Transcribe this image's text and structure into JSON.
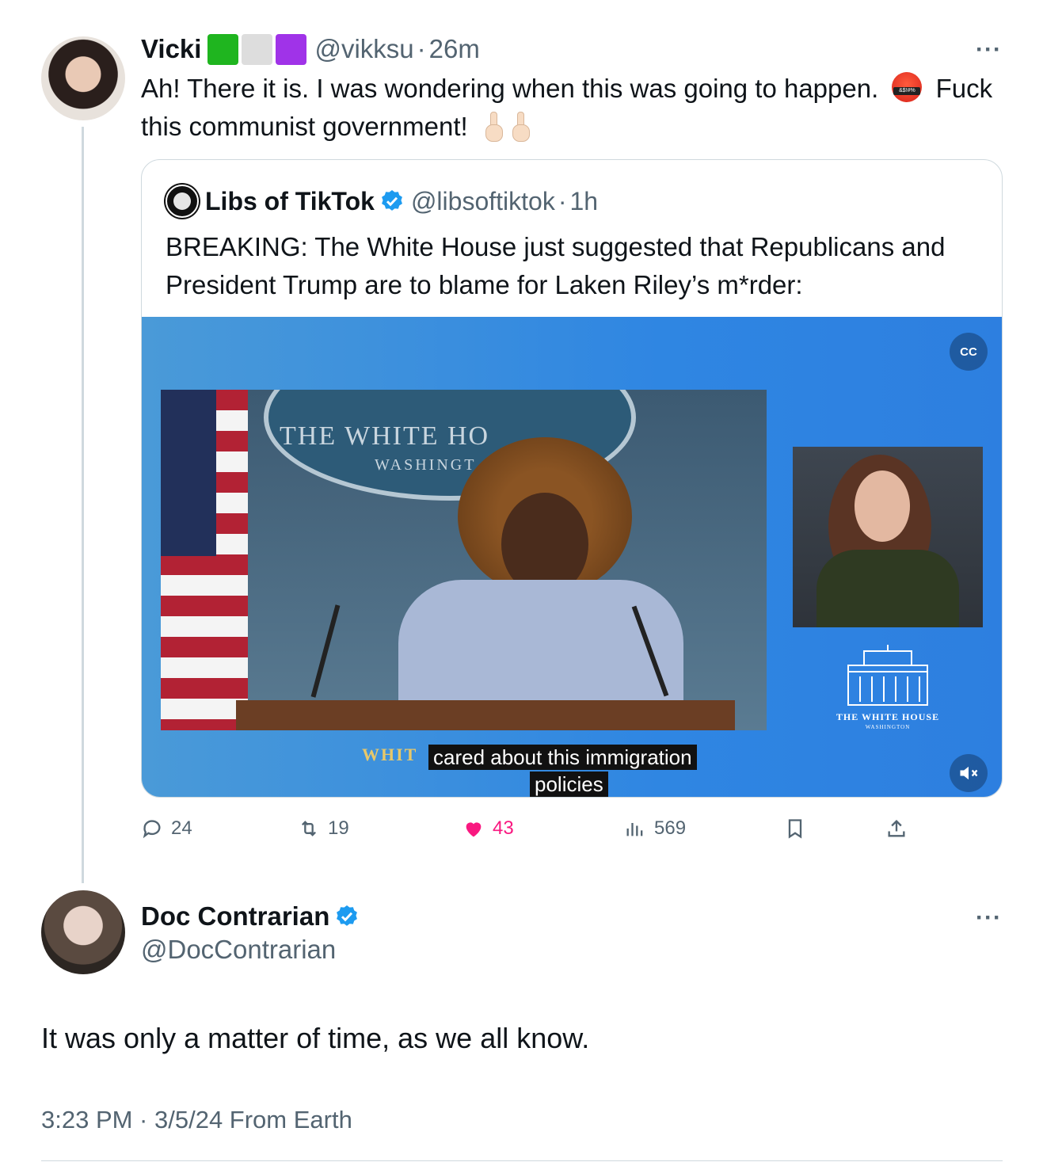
{
  "tweet1": {
    "name": "Vicki",
    "flag_colors": [
      "#1fb51f",
      "#dddddd",
      "#a033e8"
    ],
    "handle": "@vikksu",
    "separator": "·",
    "time": "26m",
    "text_part1": "Ah! There it is. I was wondering when this was going to happen.",
    "text_part2": "Fuck this communist government!",
    "emoji": [
      "angry-face-with-symbols",
      "middle-finger",
      "middle-finger"
    ],
    "more_label": "···"
  },
  "quote": {
    "name": "Libs of TikTok",
    "handle": "@libsoftiktok",
    "separator": "·",
    "time": "1h",
    "text": "BREAKING: The White House just suggested that Republicans and President Trump are to blame for Laken Riley’s m*rder:",
    "video": {
      "backdrop_title": "THE WHITE HO",
      "backdrop_sub": "WASHINGT",
      "caption_left": "WHIT",
      "caption_line1": "cared about this immigration",
      "caption_line2": "policies",
      "logo_title": "THE WHITE HOUSE",
      "logo_sub": "WASHINGTON",
      "cc_label": "CC"
    }
  },
  "actions": {
    "replies": "24",
    "reposts": "19",
    "likes": "43",
    "views": "569"
  },
  "tweet2": {
    "name": "Doc Contrarian",
    "handle": "@DocContrarian",
    "text": "It was only a matter of time, as we all know.",
    "meta": "3:23 PM · 3/5/24 From Earth",
    "more_label": "···"
  },
  "colors": {
    "accent": "#1d9bf0",
    "like": "#f91880",
    "secondary_text": "#536471",
    "border": "#cfd9de"
  }
}
